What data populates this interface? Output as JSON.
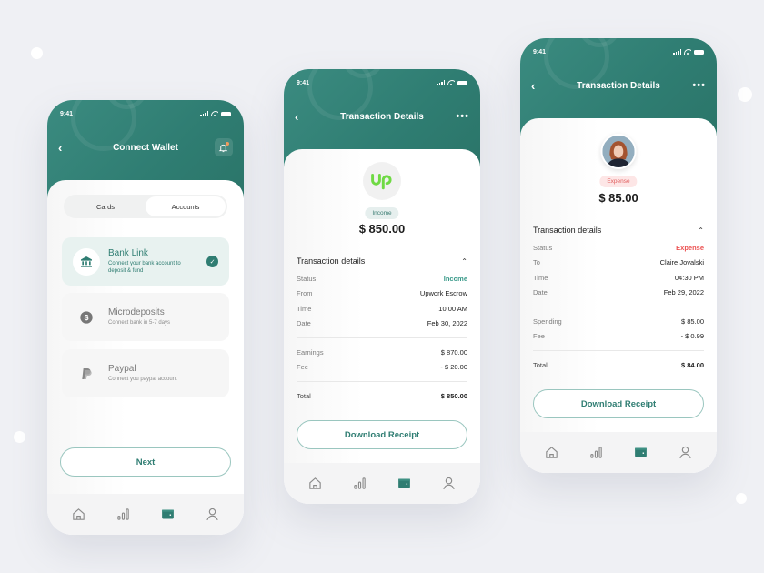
{
  "status_time": "9:41",
  "screens": {
    "connect_wallet": {
      "title": "Connect Wallet",
      "back_icon": "chevron-left-icon",
      "action_icon": "bell-icon",
      "tabs": [
        {
          "label": "Cards",
          "active": false
        },
        {
          "label": "Accounts",
          "active": true
        }
      ],
      "options": [
        {
          "icon": "bank-icon",
          "name": "Bank Link",
          "desc": "Connect your bank account to deposit & fund",
          "selected": true
        },
        {
          "icon": "dollar-icon",
          "name": "Microdeposits",
          "desc": "Connect bank in 5-7 days",
          "selected": false
        },
        {
          "icon": "paypal-icon",
          "name": "Paypal",
          "desc": "Connect you paypal account",
          "selected": false
        }
      ],
      "next_label": "Next"
    },
    "income_details": {
      "title": "Transaction Details",
      "more_icon": "more-horizontal-icon",
      "logo_text": "Up",
      "badge": "Income",
      "amount": "$ 850.00",
      "section_title": "Transaction details",
      "rows": [
        {
          "k": "Status",
          "v": "Income"
        },
        {
          "k": "From",
          "v": "Upwork Escrow"
        },
        {
          "k": "Time",
          "v": "10:00 AM"
        },
        {
          "k": "Date",
          "v": "Feb 30, 2022"
        }
      ],
      "breakdown": [
        {
          "k": "Earnings",
          "v": "$ 870.00"
        },
        {
          "k": "Fee",
          "v": "- $ 20.00"
        }
      ],
      "total": {
        "k": "Total",
        "v": "$ 850.00"
      },
      "download_label": "Download Receipt"
    },
    "expense_details": {
      "title": "Transaction Details",
      "more_icon": "more-horizontal-icon",
      "badge": "Expense",
      "amount": "$ 85.00",
      "section_title": "Transaction details",
      "rows": [
        {
          "k": "Status",
          "v": "Expense"
        },
        {
          "k": "To",
          "v": "Claire Jovalski"
        },
        {
          "k": "Time",
          "v": "04:30 PM"
        },
        {
          "k": "Date",
          "v": "Feb 29, 2022"
        }
      ],
      "breakdown": [
        {
          "k": "Spending",
          "v": "$ 85.00"
        },
        {
          "k": "Fee",
          "v": "- $ 0.99"
        }
      ],
      "total": {
        "k": "Total",
        "v": "$ 84.00"
      },
      "download_label": "Download Receipt"
    }
  },
  "tabbar": [
    {
      "icon": "home-icon",
      "active": false
    },
    {
      "icon": "chart-icon",
      "active": false
    },
    {
      "icon": "wallet-icon",
      "active": true
    },
    {
      "icon": "user-icon",
      "active": false
    }
  ],
  "colors": {
    "primary": "#2f7d72",
    "income": "#3a9a8a",
    "expense": "#ec5050",
    "upwork_green": "#6fda44",
    "background": "#eff0f4"
  }
}
